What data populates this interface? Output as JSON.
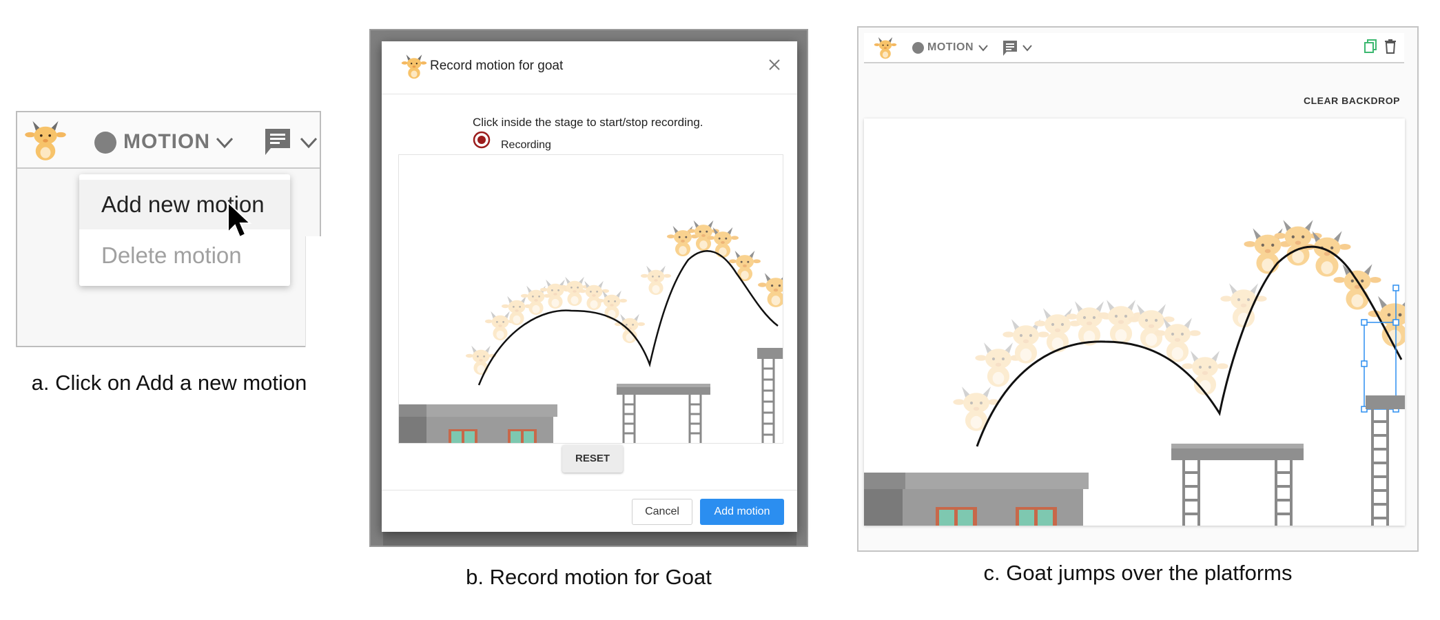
{
  "panel_a": {
    "toolbar": {
      "motion_label": "MOTION"
    },
    "menu": {
      "items": [
        {
          "label": "Add new motion",
          "enabled": true
        },
        {
          "label": "Delete motion",
          "enabled": false
        }
      ]
    },
    "caption": "a. Click on Add a new motion"
  },
  "panel_b": {
    "dialog": {
      "title": "Record motion for goat",
      "instruction": "Click inside the stage to start/stop recording.",
      "recording_label": "Recording",
      "reset_label": "RESET",
      "cancel_label": "Cancel",
      "confirm_label": "Add motion"
    },
    "caption": "b. Record motion for Goat"
  },
  "panel_c": {
    "toolbar": {
      "motion_label": "MOTION"
    },
    "clear_backdrop_label": "CLEAR BACKDROP",
    "caption": "c. Goat jumps over the platforms"
  },
  "colors": {
    "accent_blue": "#2b8ef0",
    "goat_orange": "#f7c06a",
    "recording_red": "#9b1c1c",
    "platform_gray": "#8f8f8f",
    "window_green": "#7ec8b0"
  },
  "icons": [
    "goat-avatar",
    "circle-icon",
    "chevron-down-icon",
    "comment-icon",
    "close-icon",
    "radio-icon",
    "copy-icon",
    "trash-icon",
    "cursor-icon"
  ]
}
